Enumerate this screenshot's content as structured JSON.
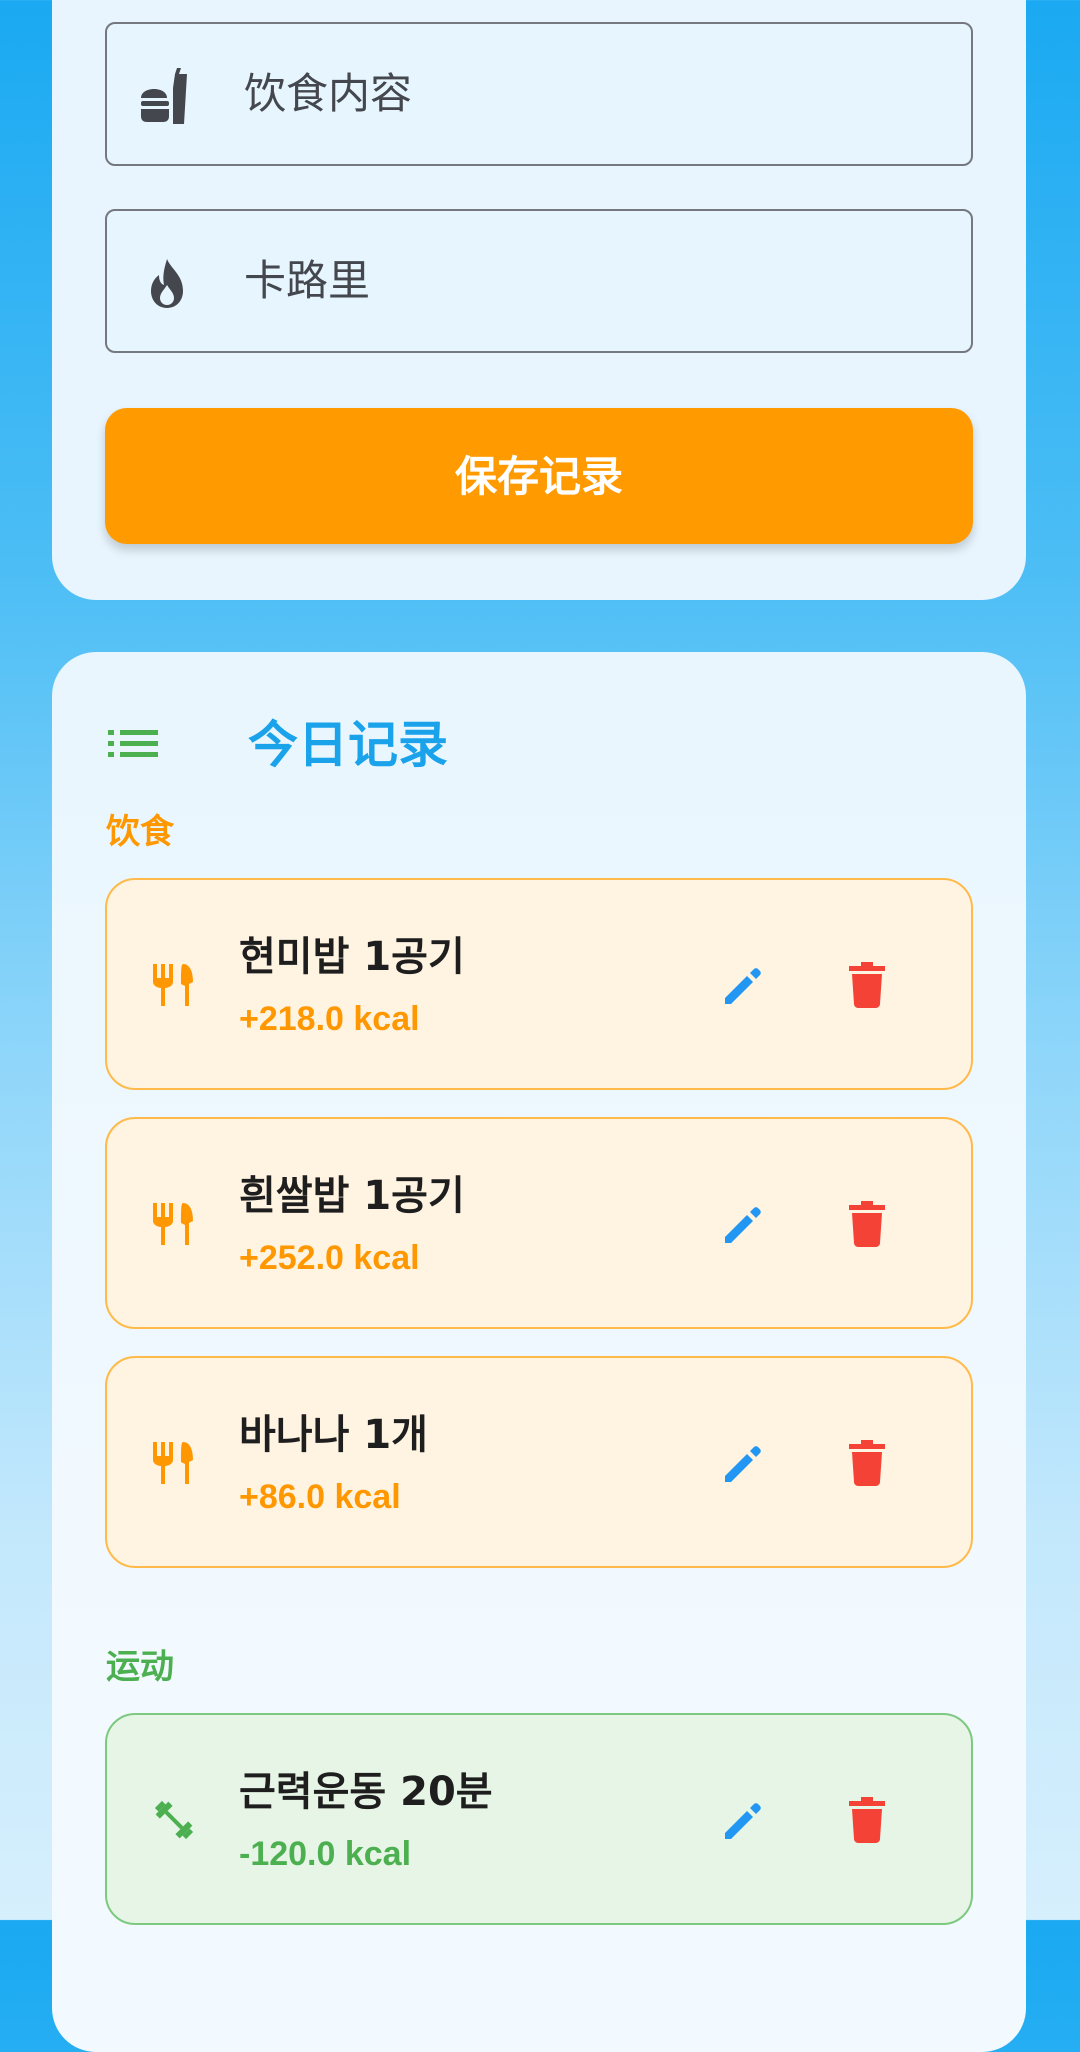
{
  "form": {
    "food_placeholder": "饮食内容",
    "calorie_placeholder": "卡路里",
    "save_label": "保存记录"
  },
  "records": {
    "title": "今日记录",
    "food_section_label": "饮食",
    "exercise_section_label": "运动",
    "food_entries": [
      {
        "name": "현미밥 1공기",
        "kcal": "+218.0 kcal"
      },
      {
        "name": "흰쌀밥 1공기",
        "kcal": "+252.0 kcal"
      },
      {
        "name": "바나나 1개",
        "kcal": "+86.0 kcal"
      }
    ],
    "exercise_entries": [
      {
        "name": "근력운동 20분",
        "kcal": "-120.0 kcal"
      }
    ]
  },
  "colors": {
    "accent_orange": "#ff9a00",
    "title_blue": "#1aa3ea",
    "exercise_green": "#4caf50",
    "delete_red": "#f44336",
    "edit_blue": "#2196f3"
  },
  "icons": {
    "food_field": "fastfood-icon",
    "calorie_field": "fire-icon",
    "records_header": "list-icon",
    "food_entry": "restaurant-icon",
    "exercise_entry": "dumbbell-icon",
    "edit": "pencil-icon",
    "delete": "trash-icon"
  }
}
